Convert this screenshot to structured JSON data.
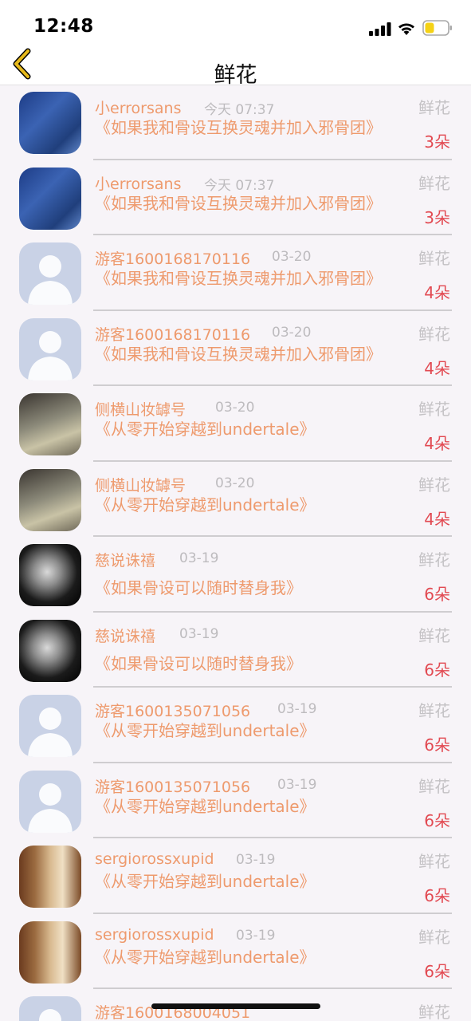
{
  "status_bar": {
    "time": "12:48"
  },
  "nav": {
    "title": "鲜花"
  },
  "items": [
    {
      "avatar": "a-sans",
      "name": "小errorsans",
      "time": "今天 07:37",
      "gift": "鲜花",
      "book": "《如果我和骨设互换灵魂并加入邪骨团》",
      "count": "3朵"
    },
    {
      "avatar": "a-sans",
      "name": "小errorsans",
      "time": "今天 07:37",
      "gift": "鲜花",
      "book": "《如果我和骨设互换灵魂并加入邪骨团》",
      "count": "3朵"
    },
    {
      "avatar": "a-default",
      "name": "游客1600168170116",
      "time": "03-20",
      "gift": "鲜花",
      "book": "《如果我和骨设互换灵魂并加入邪骨团》",
      "count": "4朵"
    },
    {
      "avatar": "a-default",
      "name": "游客1600168170116",
      "time": "03-20",
      "gift": "鲜花",
      "book": "《如果我和骨设互换灵魂并加入邪骨团》",
      "count": "4朵"
    },
    {
      "avatar": "a-girl",
      "name": "侧横山妆罅号",
      "time": "03-20",
      "gift": "鲜花",
      "book": "《从零开始穿越到undertale》",
      "count": "4朵"
    },
    {
      "avatar": "a-girl",
      "name": "侧横山妆罅号",
      "time": "03-20",
      "gift": "鲜花",
      "book": "《从零开始穿越到undertale》",
      "count": "4朵"
    },
    {
      "avatar": "a-bw",
      "name": "慈说诛禧",
      "time": "03-19",
      "gift": "鲜花",
      "book": "《如果骨设可以随时替身我》",
      "count": "6朵"
    },
    {
      "avatar": "a-bw",
      "name": "慈说诛禧",
      "time": "03-19",
      "gift": "鲜花",
      "book": "《如果骨设可以随时替身我》",
      "count": "6朵"
    },
    {
      "avatar": "a-default",
      "name": "游客1600135071056",
      "time": "03-19",
      "gift": "鲜花",
      "book": "《从零开始穿越到undertale》",
      "count": "6朵"
    },
    {
      "avatar": "a-default",
      "name": "游客1600135071056",
      "time": "03-19",
      "gift": "鲜花",
      "book": "《从零开始穿越到undertale》",
      "count": "6朵"
    },
    {
      "avatar": "a-shelf",
      "name": "sergiorossxupid",
      "time": "03-19",
      "gift": "鲜花",
      "book": "《从零开始穿越到undertale》",
      "count": "6朵"
    },
    {
      "avatar": "a-shelf",
      "name": "sergiorossxupid",
      "time": "03-19",
      "gift": "鲜花",
      "book": "《从零开始穿越到undertale》",
      "count": "6朵"
    },
    {
      "avatar": "a-default",
      "name": "游客1600168004051",
      "time": "",
      "gift": "鲜花",
      "book": "",
      "count": ""
    }
  ],
  "colors": {
    "name": "#ee9a6d",
    "count": "#e24a52",
    "muted": "#c4c2c5",
    "back_arrow": "#e6b91c",
    "battery": "#f5d216"
  },
  "icons": {
    "back": "chevron-left-icon",
    "signal": "signal-icon",
    "wifi": "wifi-icon",
    "battery": "battery-icon"
  }
}
